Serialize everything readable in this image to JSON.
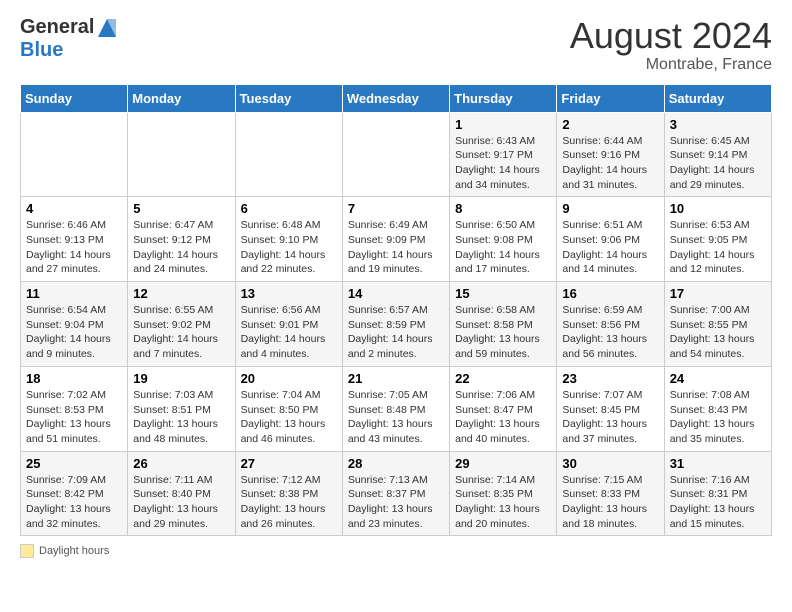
{
  "header": {
    "logo_line1": "General",
    "logo_line2": "Blue",
    "title": "August 2024",
    "subtitle": "Montrabe, France"
  },
  "days_of_week": [
    "Sunday",
    "Monday",
    "Tuesday",
    "Wednesday",
    "Thursday",
    "Friday",
    "Saturday"
  ],
  "weeks": [
    [
      {
        "num": "",
        "info": ""
      },
      {
        "num": "",
        "info": ""
      },
      {
        "num": "",
        "info": ""
      },
      {
        "num": "",
        "info": ""
      },
      {
        "num": "1",
        "info": "Sunrise: 6:43 AM\nSunset: 9:17 PM\nDaylight: 14 hours\nand 34 minutes."
      },
      {
        "num": "2",
        "info": "Sunrise: 6:44 AM\nSunset: 9:16 PM\nDaylight: 14 hours\nand 31 minutes."
      },
      {
        "num": "3",
        "info": "Sunrise: 6:45 AM\nSunset: 9:14 PM\nDaylight: 14 hours\nand 29 minutes."
      }
    ],
    [
      {
        "num": "4",
        "info": "Sunrise: 6:46 AM\nSunset: 9:13 PM\nDaylight: 14 hours\nand 27 minutes."
      },
      {
        "num": "5",
        "info": "Sunrise: 6:47 AM\nSunset: 9:12 PM\nDaylight: 14 hours\nand 24 minutes."
      },
      {
        "num": "6",
        "info": "Sunrise: 6:48 AM\nSunset: 9:10 PM\nDaylight: 14 hours\nand 22 minutes."
      },
      {
        "num": "7",
        "info": "Sunrise: 6:49 AM\nSunset: 9:09 PM\nDaylight: 14 hours\nand 19 minutes."
      },
      {
        "num": "8",
        "info": "Sunrise: 6:50 AM\nSunset: 9:08 PM\nDaylight: 14 hours\nand 17 minutes."
      },
      {
        "num": "9",
        "info": "Sunrise: 6:51 AM\nSunset: 9:06 PM\nDaylight: 14 hours\nand 14 minutes."
      },
      {
        "num": "10",
        "info": "Sunrise: 6:53 AM\nSunset: 9:05 PM\nDaylight: 14 hours\nand 12 minutes."
      }
    ],
    [
      {
        "num": "11",
        "info": "Sunrise: 6:54 AM\nSunset: 9:04 PM\nDaylight: 14 hours\nand 9 minutes."
      },
      {
        "num": "12",
        "info": "Sunrise: 6:55 AM\nSunset: 9:02 PM\nDaylight: 14 hours\nand 7 minutes."
      },
      {
        "num": "13",
        "info": "Sunrise: 6:56 AM\nSunset: 9:01 PM\nDaylight: 14 hours\nand 4 minutes."
      },
      {
        "num": "14",
        "info": "Sunrise: 6:57 AM\nSunset: 8:59 PM\nDaylight: 14 hours\nand 2 minutes."
      },
      {
        "num": "15",
        "info": "Sunrise: 6:58 AM\nSunset: 8:58 PM\nDaylight: 13 hours\nand 59 minutes."
      },
      {
        "num": "16",
        "info": "Sunrise: 6:59 AM\nSunset: 8:56 PM\nDaylight: 13 hours\nand 56 minutes."
      },
      {
        "num": "17",
        "info": "Sunrise: 7:00 AM\nSunset: 8:55 PM\nDaylight: 13 hours\nand 54 minutes."
      }
    ],
    [
      {
        "num": "18",
        "info": "Sunrise: 7:02 AM\nSunset: 8:53 PM\nDaylight: 13 hours\nand 51 minutes."
      },
      {
        "num": "19",
        "info": "Sunrise: 7:03 AM\nSunset: 8:51 PM\nDaylight: 13 hours\nand 48 minutes."
      },
      {
        "num": "20",
        "info": "Sunrise: 7:04 AM\nSunset: 8:50 PM\nDaylight: 13 hours\nand 46 minutes."
      },
      {
        "num": "21",
        "info": "Sunrise: 7:05 AM\nSunset: 8:48 PM\nDaylight: 13 hours\nand 43 minutes."
      },
      {
        "num": "22",
        "info": "Sunrise: 7:06 AM\nSunset: 8:47 PM\nDaylight: 13 hours\nand 40 minutes."
      },
      {
        "num": "23",
        "info": "Sunrise: 7:07 AM\nSunset: 8:45 PM\nDaylight: 13 hours\nand 37 minutes."
      },
      {
        "num": "24",
        "info": "Sunrise: 7:08 AM\nSunset: 8:43 PM\nDaylight: 13 hours\nand 35 minutes."
      }
    ],
    [
      {
        "num": "25",
        "info": "Sunrise: 7:09 AM\nSunset: 8:42 PM\nDaylight: 13 hours\nand 32 minutes."
      },
      {
        "num": "26",
        "info": "Sunrise: 7:11 AM\nSunset: 8:40 PM\nDaylight: 13 hours\nand 29 minutes."
      },
      {
        "num": "27",
        "info": "Sunrise: 7:12 AM\nSunset: 8:38 PM\nDaylight: 13 hours\nand 26 minutes."
      },
      {
        "num": "28",
        "info": "Sunrise: 7:13 AM\nSunset: 8:37 PM\nDaylight: 13 hours\nand 23 minutes."
      },
      {
        "num": "29",
        "info": "Sunrise: 7:14 AM\nSunset: 8:35 PM\nDaylight: 13 hours\nand 20 minutes."
      },
      {
        "num": "30",
        "info": "Sunrise: 7:15 AM\nSunset: 8:33 PM\nDaylight: 13 hours\nand 18 minutes."
      },
      {
        "num": "31",
        "info": "Sunrise: 7:16 AM\nSunset: 8:31 PM\nDaylight: 13 hours\nand 15 minutes."
      }
    ]
  ],
  "legend": {
    "label": "Daylight hours"
  }
}
